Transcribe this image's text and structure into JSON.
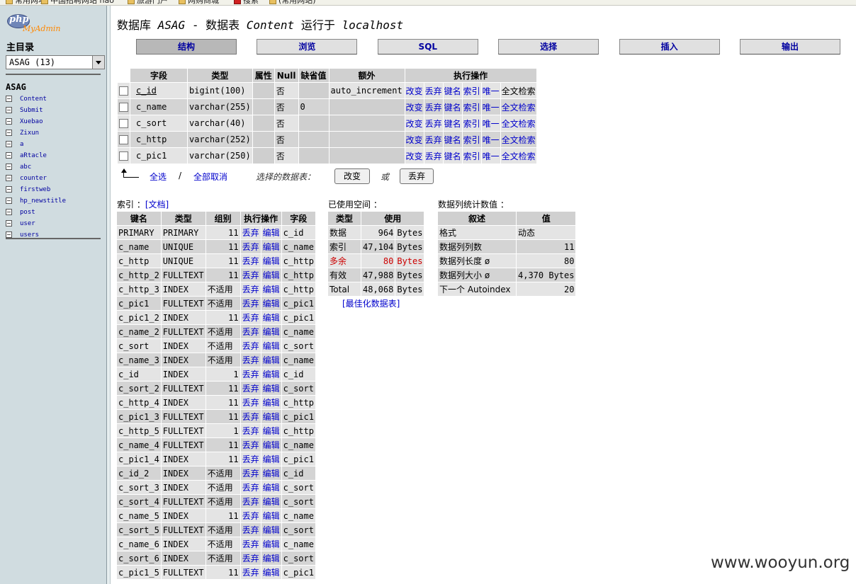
{
  "browser": {
    "bookmarks": [
      "常用网址",
      "中国招聘网站 hao",
      "旅游门户",
      "网购商城",
      "搜索",
      "(常用网站)"
    ]
  },
  "sidebar": {
    "logo_php": "php",
    "logo_myadmin": "MyAdmin",
    "home_label": "主目录",
    "db_select_value": "ASAG (13)",
    "db_name": "ASAG",
    "tables": [
      "Content",
      "Submit",
      "Xuebao",
      "Zixun",
      "a",
      "aRtacle",
      "abc",
      "counter",
      "firstweb",
      "hp_newstitle",
      "post",
      "user",
      "users"
    ]
  },
  "main": {
    "title_db_prefix": "数据库",
    "title_db": "ASAG",
    "title_sep": "- 数据表",
    "title_table": "Content",
    "title_run": "运行于",
    "title_host": "localhost",
    "tabs": [
      {
        "label": "结构",
        "active": true
      },
      {
        "label": "浏览",
        "active": false
      },
      {
        "label": "SQL",
        "active": false
      },
      {
        "label": "选择",
        "active": false
      },
      {
        "label": "插入",
        "active": false
      },
      {
        "label": "输出",
        "active": false
      }
    ]
  },
  "structure": {
    "headers": {
      "field": "字段",
      "type": "类型",
      "attributes": "属性",
      "null": "Null",
      "default": "缺省值",
      "extra": "额外",
      "action": "执行操作"
    },
    "actions": {
      "change": "改变",
      "drop": "丢弃",
      "primary": "键名",
      "index": "索引",
      "unique": "唯一",
      "fulltext": "全文检索"
    },
    "rows": [
      {
        "field": "c_id",
        "type": "bigint(100)",
        "attributes": "",
        "null": "否",
        "default": "",
        "extra": "auto_increment",
        "primary": true
      },
      {
        "field": "c_name",
        "type": "varchar(255)",
        "attributes": "",
        "null": "否",
        "default": "0",
        "extra": "",
        "primary": false
      },
      {
        "field": "c_sort",
        "type": "varchar(40)",
        "attributes": "",
        "null": "否",
        "default": "",
        "extra": "",
        "primary": false
      },
      {
        "field": "c_http",
        "type": "varchar(252)",
        "attributes": "",
        "null": "否",
        "default": "",
        "extra": "",
        "primary": false
      },
      {
        "field": "c_pic1",
        "type": "varchar(250)",
        "attributes": "",
        "null": "否",
        "default": "",
        "extra": "",
        "primary": false
      }
    ],
    "check_all": "全选",
    "separator": "/",
    "uncheck_all": "全部取消",
    "with_selected": "选择的数据表：",
    "change_button": "改变",
    "or_label": "或",
    "drop_button": "丢弃"
  },
  "indexes": {
    "label": "索引 ：",
    "docs_link": "[文档]",
    "headers": {
      "keyname": "键名",
      "type": "类型",
      "cardinality": "组别",
      "action": "执行操作",
      "field": "字段"
    },
    "drop_label": "丢弃",
    "edit_label": "编辑",
    "rows": [
      {
        "keyname": "PRIMARY",
        "type": "PRIMARY",
        "cardinality": "11",
        "field": "c_id"
      },
      {
        "keyname": "c_name",
        "type": "UNIQUE",
        "cardinality": "11",
        "field": "c_name"
      },
      {
        "keyname": "c_http",
        "type": "UNIQUE",
        "cardinality": "11",
        "field": "c_http"
      },
      {
        "keyname": "c_http_2",
        "type": "FULLTEXT",
        "cardinality": "11",
        "field": "c_http"
      },
      {
        "keyname": "c_http_3",
        "type": "INDEX",
        "cardinality": "不适用",
        "field": "c_http"
      },
      {
        "keyname": "c_pic1",
        "type": "FULLTEXT",
        "cardinality": "不适用",
        "field": "c_pic1"
      },
      {
        "keyname": "c_pic1_2",
        "type": "INDEX",
        "cardinality": "11",
        "field": "c_pic1"
      },
      {
        "keyname": "c_name_2",
        "type": "FULLTEXT",
        "cardinality": "不适用",
        "field": "c_name"
      },
      {
        "keyname": "c_sort",
        "type": "INDEX",
        "cardinality": "不适用",
        "field": "c_sort"
      },
      {
        "keyname": "c_name_3",
        "type": "INDEX",
        "cardinality": "不适用",
        "field": "c_name"
      },
      {
        "keyname": "c_id",
        "type": "INDEX",
        "cardinality": "1",
        "field": "c_id"
      },
      {
        "keyname": "c_sort_2",
        "type": "FULLTEXT",
        "cardinality": "11",
        "field": "c_sort"
      },
      {
        "keyname": "c_http_4",
        "type": "INDEX",
        "cardinality": "11",
        "field": "c_http"
      },
      {
        "keyname": "c_pic1_3",
        "type": "FULLTEXT",
        "cardinality": "11",
        "field": "c_pic1"
      },
      {
        "keyname": "c_http_5",
        "type": "FULLTEXT",
        "cardinality": "1",
        "field": "c_http"
      },
      {
        "keyname": "c_name_4",
        "type": "FULLTEXT",
        "cardinality": "11",
        "field": "c_name"
      },
      {
        "keyname": "c_pic1_4",
        "type": "INDEX",
        "cardinality": "11",
        "field": "c_pic1"
      },
      {
        "keyname": "c_id_2",
        "type": "INDEX",
        "cardinality": "不适用",
        "field": "c_id"
      },
      {
        "keyname": "c_sort_3",
        "type": "INDEX",
        "cardinality": "不适用",
        "field": "c_sort"
      },
      {
        "keyname": "c_sort_4",
        "type": "FULLTEXT",
        "cardinality": "不适用",
        "field": "c_sort"
      },
      {
        "keyname": "c_name_5",
        "type": "INDEX",
        "cardinality": "11",
        "field": "c_name"
      },
      {
        "keyname": "c_sort_5",
        "type": "FULLTEXT",
        "cardinality": "不适用",
        "field": "c_sort"
      },
      {
        "keyname": "c_name_6",
        "type": "INDEX",
        "cardinality": "不适用",
        "field": "c_name"
      },
      {
        "keyname": "c_sort_6",
        "type": "INDEX",
        "cardinality": "不适用",
        "field": "c_sort"
      },
      {
        "keyname": "c_pic1_5",
        "type": "FULLTEXT",
        "cardinality": "11",
        "field": "c_pic1"
      }
    ]
  },
  "space": {
    "label": "已使用空间 ：",
    "headers": {
      "type": "类型",
      "usage": "使用"
    },
    "rows": [
      {
        "type": "数据",
        "value": "964",
        "unit": "Bytes",
        "overhead": false
      },
      {
        "type": "索引",
        "value": "47,104",
        "unit": "Bytes",
        "overhead": false
      },
      {
        "type": "多余",
        "value": "80",
        "unit": "Bytes",
        "overhead": true
      },
      {
        "type": "有效",
        "value": "47,988",
        "unit": "Bytes",
        "overhead": false
      },
      {
        "type": "Total",
        "value": "48,068",
        "unit": "Bytes",
        "overhead": false
      }
    ],
    "optimize_link": "[最佳化数据表]"
  },
  "stats": {
    "label": "数据列统计数值 ：",
    "headers": {
      "statement": "叙述",
      "value": "值"
    },
    "rows": [
      {
        "statement": "格式",
        "value": "动态",
        "align": "left"
      },
      {
        "statement": "数据列列数",
        "value": "11",
        "align": "right"
      },
      {
        "statement": "数据列长度 ø",
        "value": "80",
        "align": "right"
      },
      {
        "statement": "数据列大小  ø",
        "value": "4,370 Bytes",
        "align": "right"
      },
      {
        "statement": "下一个 Autoindex",
        "value": "20",
        "align": "right"
      }
    ]
  },
  "watermark": "www.wooyun.org",
  "colors": {
    "sidebar_bg": "#d0dce0",
    "header_bg": "#d0d0d0",
    "row_odd": "#e4e4e4",
    "row_even": "#d4d4d4",
    "link": "#0000cc",
    "overhead": "#cc0000",
    "logo_orange": "#ff8800"
  }
}
